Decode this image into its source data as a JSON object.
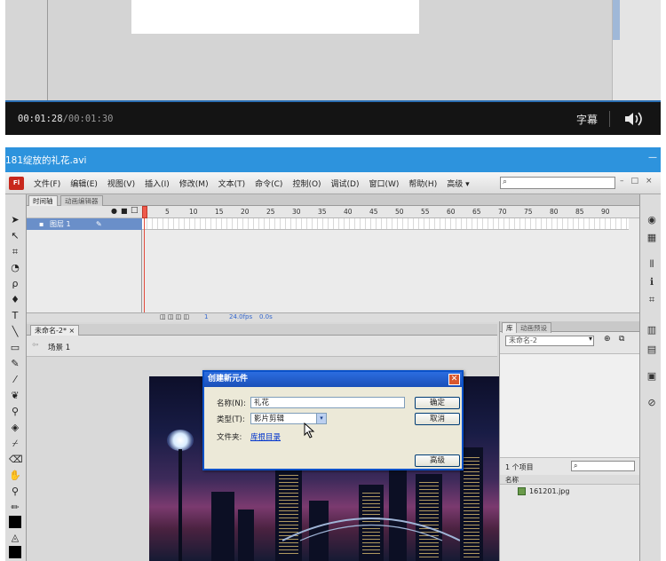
{
  "player1": {
    "current_time": "00:01:28",
    "duration": "/00:01:30",
    "subtitle_label": "字幕"
  },
  "window2": {
    "title": "181绽放的礼花.avi",
    "menu": [
      "文件(F)",
      "编辑(E)",
      "视图(V)",
      "插入(I)",
      "修改(M)",
      "文本(T)",
      "命令(C)",
      "控制(O)",
      "调试(D)",
      "窗口(W)",
      "帮助(H)",
      "高级 ▾"
    ],
    "app_icon": "Fl",
    "timeline": {
      "tab_active": "时间轴",
      "tab_inactive": "动画编辑器",
      "layer_name": "图层 1",
      "ruler": [
        "1",
        "5",
        "10",
        "15",
        "20",
        "25",
        "30",
        "35",
        "40",
        "45",
        "50",
        "55",
        "60",
        "65",
        "70",
        "75",
        "80",
        "85",
        "90"
      ],
      "frame": "1",
      "fps": "24.0fps",
      "time": "0.0s"
    },
    "document_tab": "未命名-2* ×",
    "scene": "场景 1"
  },
  "dialog": {
    "title": "创建新元件",
    "name_label": "名称(N):",
    "name_value": "礼花",
    "type_label": "类型(T):",
    "type_value": "影片剪辑",
    "folder_label": "文件夹:",
    "folder_link": "库根目录",
    "ok": "确定",
    "cancel": "取消",
    "advanced": "高级"
  },
  "library": {
    "tab_library": "库",
    "tab_preset": "动画预设",
    "doc_select": "未命名-2",
    "item_count": "1 个项目",
    "col_name": "名称",
    "items": [
      "161201.jpg"
    ]
  },
  "colors": {
    "title_blue": "#2d93dd",
    "dialog_blue": "#0a51c8",
    "progress_blue": "#2b6fb3"
  }
}
